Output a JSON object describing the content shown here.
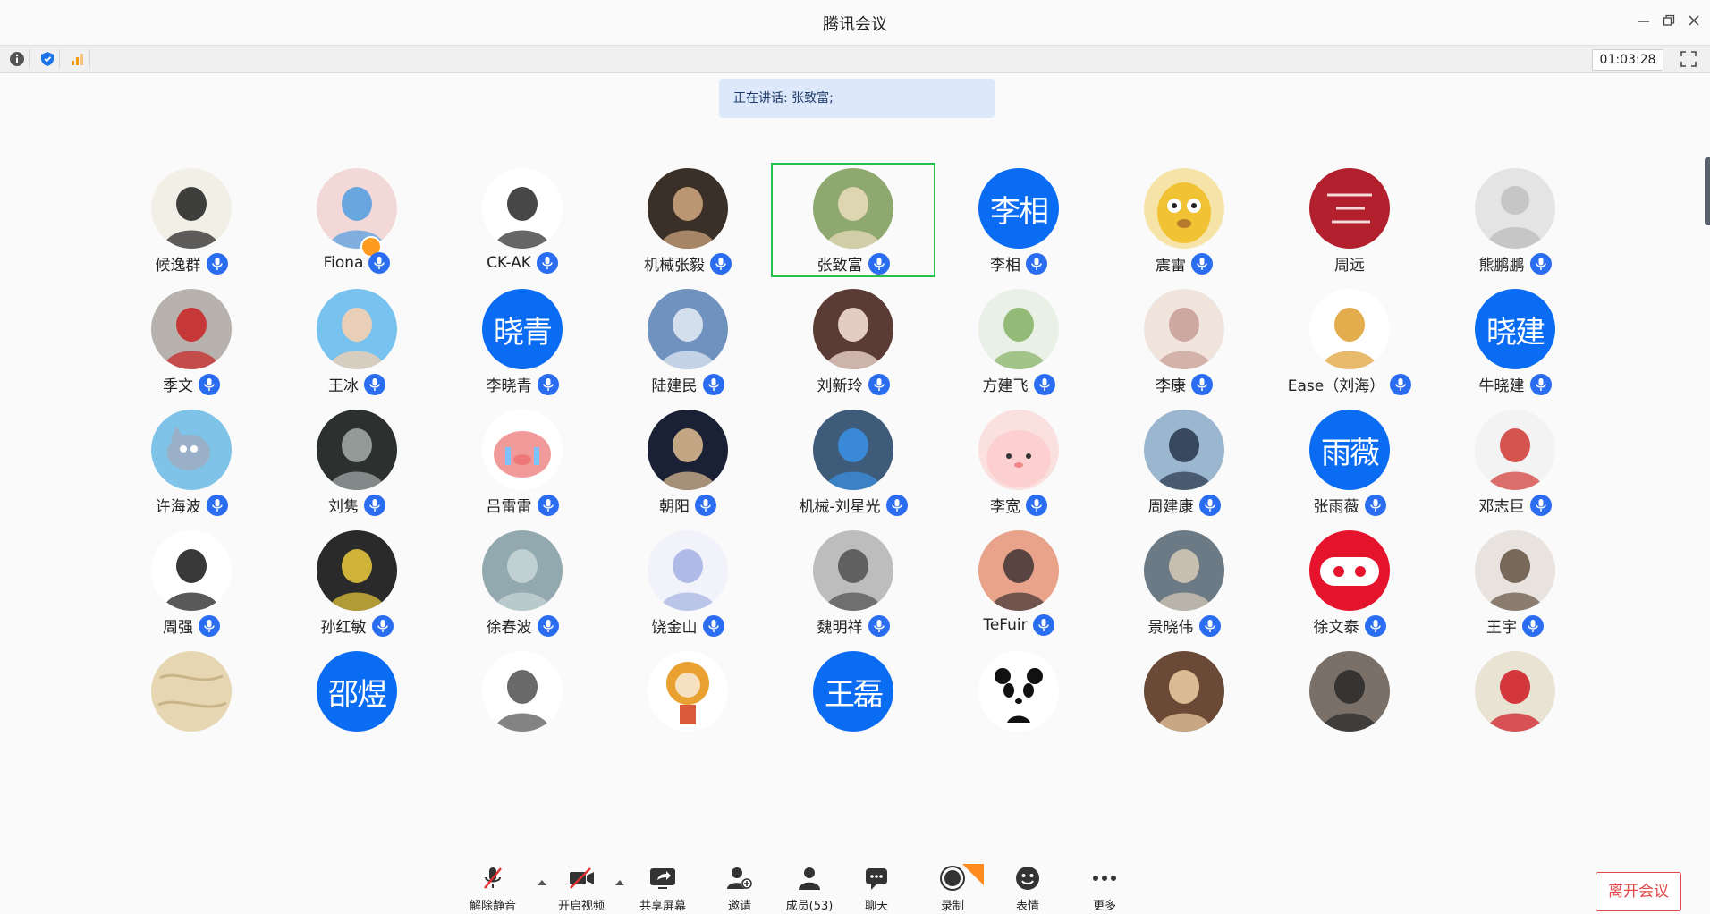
{
  "window": {
    "title": "腾讯会议"
  },
  "infobar": {
    "timer": "01:03:28"
  },
  "speaking": {
    "text": "正在讲话: 张致富;"
  },
  "participants": [
    {
      "name": "候逸群",
      "avatar": "anime-boy",
      "bg": "#f2efe6",
      "fg": "#2a2a2a"
    },
    {
      "name": "Fiona",
      "avatar": "girl-bow",
      "bg": "#f3d8d8",
      "fg": "#5aa0e0",
      "host": true
    },
    {
      "name": "CK-AK",
      "avatar": "sketch-girl",
      "bg": "#ffffff",
      "fg": "#333333"
    },
    {
      "name": "机械张毅",
      "avatar": "photo-duck",
      "bg": "#3a3028",
      "fg": "#c9a27a"
    },
    {
      "name": "张致富",
      "avatar": "photo-mountain",
      "bg": "#8fa870",
      "fg": "#e7d9b8",
      "active": true
    },
    {
      "name": "李相",
      "avatar": "text",
      "text": "李相"
    },
    {
      "name": "震雷",
      "avatar": "cartoon-face",
      "bg": "#f1c233",
      "fg": "#b57a2b"
    },
    {
      "name": "周远",
      "avatar": "red-calligraphy",
      "bg": "#b2202e",
      "fg": "#f7d9d9",
      "nomic": true
    },
    {
      "name": "熊鹏鹏",
      "avatar": "default-user",
      "bg": "#e4e4e4",
      "fg": "#c6c6c6"
    },
    {
      "name": "季文",
      "avatar": "photo-robot",
      "bg": "#b7b2ad",
      "fg": "#c82a2a"
    },
    {
      "name": "王冰",
      "avatar": "crayon-shin",
      "bg": "#78c2f0",
      "fg": "#f5d0b0"
    },
    {
      "name": "李晓青",
      "avatar": "text",
      "text": "晓青"
    },
    {
      "name": "陆建民",
      "avatar": "photo-sky",
      "bg": "#6f93be",
      "fg": "#dfe8f2"
    },
    {
      "name": "刘新玲",
      "avatar": "photo-woman",
      "bg": "#5b3b35",
      "fg": "#f2ddd2"
    },
    {
      "name": "方建飞",
      "avatar": "photo-grass",
      "bg": "#e9f0e6",
      "fg": "#8ab56a"
    },
    {
      "name": "李康",
      "avatar": "photo-sunset",
      "bg": "#f0e4dc",
      "fg": "#c9a19a"
    },
    {
      "name": "Ease（刘海）",
      "avatar": "cartoon-cat",
      "bg": "#ffffff",
      "fg": "#e0a33a"
    },
    {
      "name": "牛晓建",
      "avatar": "text",
      "text": "晓建"
    },
    {
      "name": "许海波",
      "avatar": "tom-cat",
      "bg": "#7fc3e8",
      "fg": "#9ab0c8"
    },
    {
      "name": "刘隽",
      "avatar": "photo-dark-man",
      "bg": "#2c3130",
      "fg": "#9fa7a5"
    },
    {
      "name": "吕雷雷",
      "avatar": "crying-pig",
      "bg": "#ffffff",
      "fg": "#f19a9a"
    },
    {
      "name": "朝阳",
      "avatar": "photo-guitar",
      "bg": "#1b2135",
      "fg": "#d6b68e"
    },
    {
      "name": "机械-刘星光",
      "avatar": "photo-blue-boy",
      "bg": "#3e5b7a",
      "fg": "#3a8ee0"
    },
    {
      "name": "李宽",
      "avatar": "pink-blob",
      "bg": "#fbe0e0",
      "fg": "#f0a5a5"
    },
    {
      "name": "周建康",
      "avatar": "photo-sea",
      "bg": "#9ab7cf",
      "fg": "#2c3c52"
    },
    {
      "name": "张雨薇",
      "avatar": "text",
      "text": "雨薇"
    },
    {
      "name": "邓志巨",
      "avatar": "photo-fruit",
      "bg": "#f3f3f3",
      "fg": "#d3423d"
    },
    {
      "name": "周强",
      "avatar": "cartoon-mask",
      "bg": "#ffffff",
      "fg": "#222222"
    },
    {
      "name": "孙红敏",
      "avatar": "photo-neon",
      "bg": "#2a2a2a",
      "fg": "#e0c23a"
    },
    {
      "name": "徐春波",
      "avatar": "photo-fog",
      "bg": "#93a9b0",
      "fg": "#c7d4d6"
    },
    {
      "name": "饶金山",
      "avatar": "cartoon-boy",
      "bg": "#f2f2fb",
      "fg": "#a7b5e3"
    },
    {
      "name": "魏明祥",
      "avatar": "photo-tree",
      "bg": "#bdbdbd",
      "fg": "#555555"
    },
    {
      "name": "TeFuir",
      "avatar": "photo-pink-sky",
      "bg": "#e9a38a",
      "fg": "#4a3a3a"
    },
    {
      "name": "景晓伟",
      "avatar": "photo-torch",
      "bg": "#6b7a85",
      "fg": "#d2c8b6"
    },
    {
      "name": "徐文泰",
      "avatar": "red-robot",
      "bg": "#e6132c",
      "fg": "#ffffff"
    },
    {
      "name": "王宇",
      "avatar": "photo-couple",
      "bg": "#e8e3de",
      "fg": "#6b5a4a"
    },
    {
      "name": "",
      "avatar": "texture",
      "bg": "#e6d7b2",
      "fg": "#c9b489",
      "noname": true
    },
    {
      "name": "",
      "avatar": "text",
      "text": "邵煜",
      "noname": true
    },
    {
      "name": "",
      "avatar": "wolf-cartoon",
      "bg": "#ffffff",
      "fg": "#5a5a5a",
      "noname": true
    },
    {
      "name": "",
      "avatar": "sun-flower",
      "bg": "#ffffff",
      "fg": "#e9a232",
      "noname": true
    },
    {
      "name": "",
      "avatar": "text",
      "text": "王磊",
      "noname": true
    },
    {
      "name": "",
      "avatar": "panda",
      "bg": "#ffffff",
      "fg": "#111111",
      "noname": true
    },
    {
      "name": "",
      "avatar": "photo-bear",
      "bg": "#6a4a36",
      "fg": "#e8c69f",
      "noname": true
    },
    {
      "name": "",
      "avatar": "photo-street",
      "bg": "#7a7068",
      "fg": "#2e2e2e",
      "noname": true
    },
    {
      "name": "",
      "avatar": "photo-red-hat",
      "bg": "#e8e3d2",
      "fg": "#d0222a",
      "noname": true
    }
  ],
  "toolbar": {
    "unmute": "解除静音",
    "video": "开启视频",
    "share": "共享屏幕",
    "invite": "邀请",
    "members": "成员(53)",
    "chat": "聊天",
    "record": "录制",
    "emoji": "表情",
    "more": "更多",
    "leave": "离开会议"
  }
}
